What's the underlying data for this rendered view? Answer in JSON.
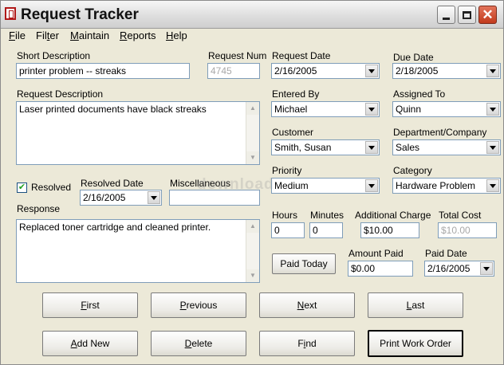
{
  "window": {
    "title": "Request Tracker"
  },
  "menu": [
    {
      "label": "File",
      "accel": "F",
      "rest": "ile"
    },
    {
      "label": "Filter",
      "accel": "t",
      "rest": ""
    },
    {
      "label": "Maintain",
      "accel": "M",
      "rest": "aintain"
    },
    {
      "label": "Reports",
      "accel": "R",
      "rest": "eports"
    },
    {
      "label": "Help",
      "accel": "H",
      "rest": "elp"
    }
  ],
  "form": {
    "short_description": {
      "label": "Short Description",
      "value": "printer problem -- streaks"
    },
    "request_num": {
      "label": "Request Num",
      "value": "4745"
    },
    "request_date": {
      "label": "Request Date",
      "value": "2/16/2005"
    },
    "due_date": {
      "label": "Due Date",
      "value": "2/18/2005"
    },
    "request_description": {
      "label": "Request Description",
      "value": "Laser printed documents have black streaks"
    },
    "entered_by": {
      "label": "Entered By",
      "value": "Michael"
    },
    "assigned_to": {
      "label": "Assigned To",
      "value": "Quinn"
    },
    "customer": {
      "label": "Customer",
      "value": "Smith, Susan"
    },
    "department": {
      "label": "Department/Company",
      "value": "Sales"
    },
    "priority": {
      "label": "Priority",
      "value": "Medium"
    },
    "category": {
      "label": "Category",
      "value": "Hardware Problem"
    },
    "resolved": {
      "label": "Resolved",
      "checked": true
    },
    "resolved_date": {
      "label": "Resolved Date",
      "value": "2/16/2005"
    },
    "miscellaneous": {
      "label": "Miscellaneous",
      "value": ""
    },
    "response": {
      "label": "Response",
      "value": "Replaced toner cartridge and cleaned printer."
    },
    "hours": {
      "label": "Hours",
      "value": "0"
    },
    "minutes": {
      "label": "Minutes",
      "value": "0"
    },
    "additional_charge": {
      "label": "Additional  Charge",
      "value": "$10.00"
    },
    "total_cost": {
      "label": "Total Cost",
      "value": "$10.00"
    },
    "amount_paid": {
      "label": "Amount Paid",
      "value": "$0.00"
    },
    "paid_date": {
      "label": "Paid Date",
      "value": "2/16/2005"
    }
  },
  "buttons": {
    "paid_today": "Paid Today",
    "first": {
      "accel": "F",
      "rest": "irst"
    },
    "previous": {
      "accel": "P",
      "rest": "revious"
    },
    "next": {
      "accel": "N",
      "rest": "ext"
    },
    "last": {
      "accel": "L",
      "rest": "ast"
    },
    "add_new": {
      "accel": "A",
      "rest": "dd New"
    },
    "delete": {
      "accel": "D",
      "rest": "elete"
    },
    "find": {
      "accel": "i",
      "pre": "F",
      "rest": "nd"
    },
    "print_work_order": "Print Work Order"
  },
  "watermark": "download"
}
